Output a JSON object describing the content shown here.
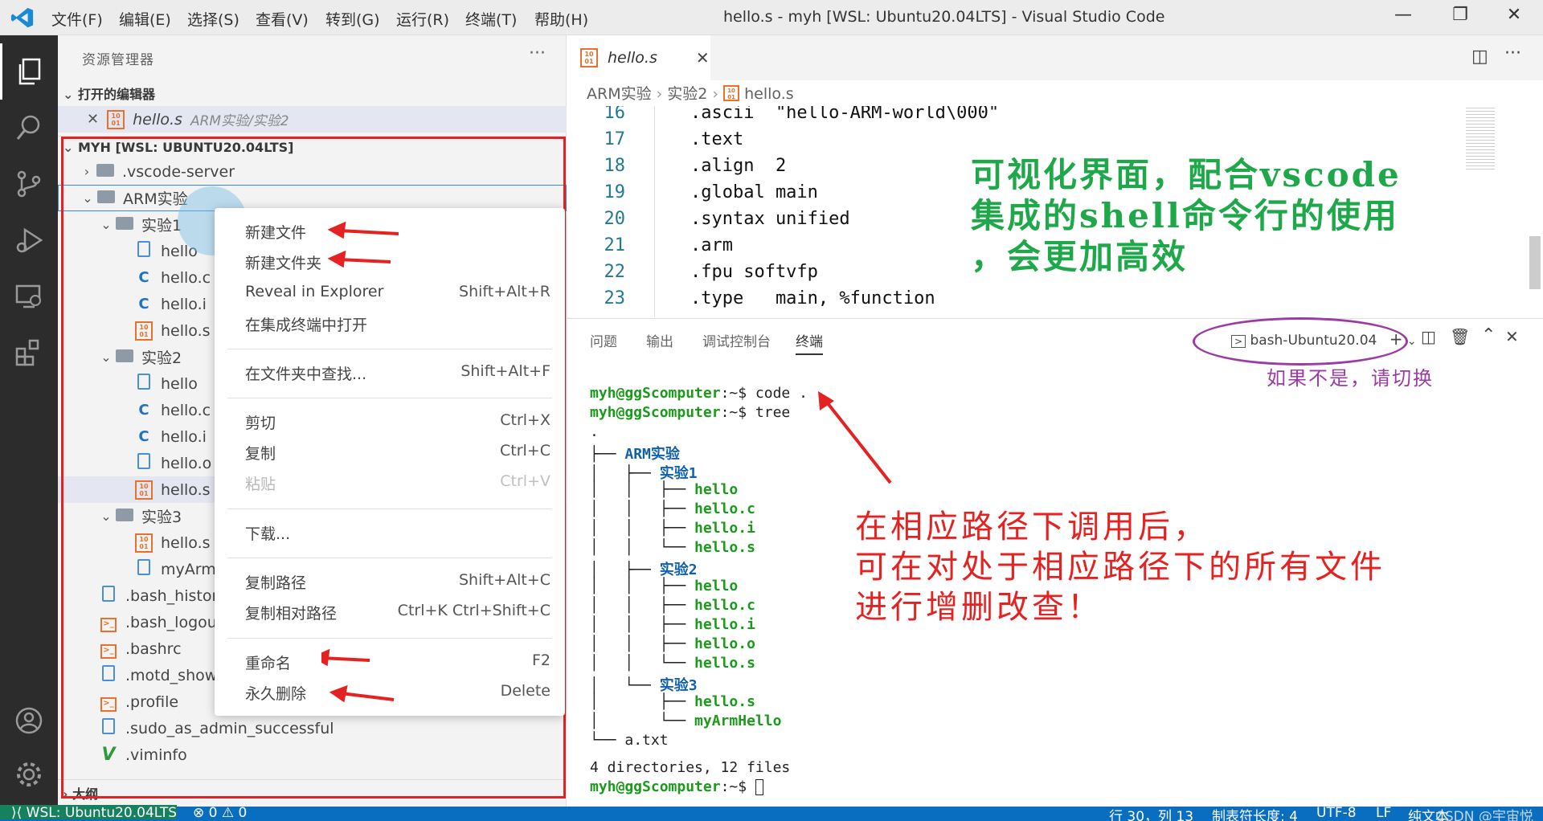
{
  "titlebar": {
    "menus": [
      "文件(F)",
      "编辑(E)",
      "选择(S)",
      "查看(V)",
      "转到(G)",
      "运行(R)",
      "终端(T)",
      "帮助(H)"
    ],
    "title": "hello.s - myh [WSL: Ubuntu20.04LTS] - Visual Studio Code"
  },
  "sidebar": {
    "title": "资源管理器",
    "open_editors_header": "打开的编辑器",
    "open_editor_file": "hello.s",
    "open_editor_path": "ARM实验/实验2",
    "workspace_header": "MYH [WSL: UBUNTU20.04LTS]",
    "outline_header": "大纲",
    "tree": [
      {
        "label": ".vscode-server"
      },
      {
        "label": "ARM实验"
      },
      {
        "label": "实验1"
      },
      {
        "label": "hello"
      },
      {
        "label": "hello.c"
      },
      {
        "label": "hello.i"
      },
      {
        "label": "hello.s"
      },
      {
        "label": "实验2"
      },
      {
        "label": "hello"
      },
      {
        "label": "hello.c"
      },
      {
        "label": "hello.i"
      },
      {
        "label": "hello.o"
      },
      {
        "label": "hello.s"
      },
      {
        "label": "实验3"
      },
      {
        "label": "hello.s"
      },
      {
        "label": "myArmHe"
      },
      {
        "label": ".bash_history"
      },
      {
        "label": ".bash_logout"
      },
      {
        "label": ".bashrc"
      },
      {
        "label": ".motd_shown"
      },
      {
        "label": ".profile"
      },
      {
        "label": ".sudo_as_admin_successful"
      },
      {
        "label": ".viminfo"
      }
    ]
  },
  "context_menu": {
    "items": [
      {
        "label": "新建文件",
        "key": ""
      },
      {
        "label": "新建文件夹",
        "key": ""
      },
      {
        "label": "Reveal in Explorer",
        "key": "Shift+Alt+R"
      },
      {
        "label": "在集成终端中打开",
        "key": ""
      },
      {
        "label": "在文件夹中查找...",
        "key": "Shift+Alt+F"
      },
      {
        "label": "剪切",
        "key": "Ctrl+X"
      },
      {
        "label": "复制",
        "key": "Ctrl+C"
      },
      {
        "label": "粘贴",
        "key": "Ctrl+V"
      },
      {
        "label": "下载...",
        "key": ""
      },
      {
        "label": "复制路径",
        "key": "Shift+Alt+C"
      },
      {
        "label": "复制相对路径",
        "key": "Ctrl+K Ctrl+Shift+C"
      },
      {
        "label": "重命名",
        "key": "F2"
      },
      {
        "label": "永久删除",
        "key": "Delete"
      }
    ]
  },
  "editor": {
    "tab_label": "hello.s",
    "breadcrumb": [
      "ARM实验",
      "实验2",
      "hello.s"
    ],
    "lines": [
      {
        "n": "16",
        "code": "    .ascii  \"hello-ARM-world\\000\""
      },
      {
        "n": "17",
        "code": "    .text"
      },
      {
        "n": "18",
        "code": "    .align  2"
      },
      {
        "n": "19",
        "code": "    .global main"
      },
      {
        "n": "20",
        "code": "    .syntax unified"
      },
      {
        "n": "21",
        "code": "    .arm"
      },
      {
        "n": "22",
        "code": "    .fpu softvfp"
      },
      {
        "n": "23",
        "code": "    .type   main, %function"
      }
    ],
    "annotation": [
      "可视化界面，配合vscode",
      "集成的shell命令行的使用",
      "，会更加高效"
    ]
  },
  "panel": {
    "tabs": [
      "问题",
      "输出",
      "调试控制台",
      "终端"
    ],
    "terminal_name": "bash-Ubuntu20.04",
    "switch_note": "如果不是，请切换",
    "prompt_user": "myh@ggScomputer",
    "prompt_path": ":~$",
    "cmd1": " code .",
    "cmd2": " tree",
    "tree_lines": [
      {
        "prefix": ".",
        "name": "",
        "cls": ""
      },
      {
        "prefix": "├── ",
        "name": "ARM实验",
        "cls": "blue"
      },
      {
        "prefix": "│   ├── ",
        "name": "实验1",
        "cls": "blue"
      },
      {
        "prefix": "│   │   ├── ",
        "name": "hello",
        "cls": "green"
      },
      {
        "prefix": "│   │   ├── ",
        "name": "hello.c",
        "cls": "green"
      },
      {
        "prefix": "│   │   ├── ",
        "name": "hello.i",
        "cls": "green"
      },
      {
        "prefix": "│   │   └── ",
        "name": "hello.s",
        "cls": "green"
      },
      {
        "prefix": "│   ├── ",
        "name": "实验2",
        "cls": "blue"
      },
      {
        "prefix": "│   │   ├── ",
        "name": "hello",
        "cls": "green"
      },
      {
        "prefix": "│   │   ├── ",
        "name": "hello.c",
        "cls": "green"
      },
      {
        "prefix": "│   │   ├── ",
        "name": "hello.i",
        "cls": "green"
      },
      {
        "prefix": "│   │   ├── ",
        "name": "hello.o",
        "cls": "green"
      },
      {
        "prefix": "│   │   └── ",
        "name": "hello.s",
        "cls": "green"
      },
      {
        "prefix": "│   └── ",
        "name": "实验3",
        "cls": "blue"
      },
      {
        "prefix": "│       ├── ",
        "name": "hello.s",
        "cls": "green"
      },
      {
        "prefix": "│       └── ",
        "name": "myArmHello",
        "cls": "green"
      },
      {
        "prefix": "└── ",
        "name": "a.txt",
        "cls": ""
      }
    ],
    "summary": "4 directories, 12 files",
    "annotation": [
      "在相应路径下调用后，",
      "可在对处于相应路径下的所有文件",
      "进行增删改查！"
    ]
  },
  "statusbar": {
    "remote": "WSL: Ubuntu20.04LTS",
    "problems": "⊗ 0 ⚠ 0",
    "position": "行 30，列 13",
    "tab_size": "制表符长度: 4",
    "encoding": "UTF-8",
    "eol": "LF",
    "language": "纯文本",
    "watermark": "CSDN @宇宙悦"
  },
  "colors": {
    "accent": "#0a6ec0",
    "annotation_red": "#e52222",
    "annotation_green": "#1fa84a",
    "annotation_purple": "#9b3ba3"
  }
}
